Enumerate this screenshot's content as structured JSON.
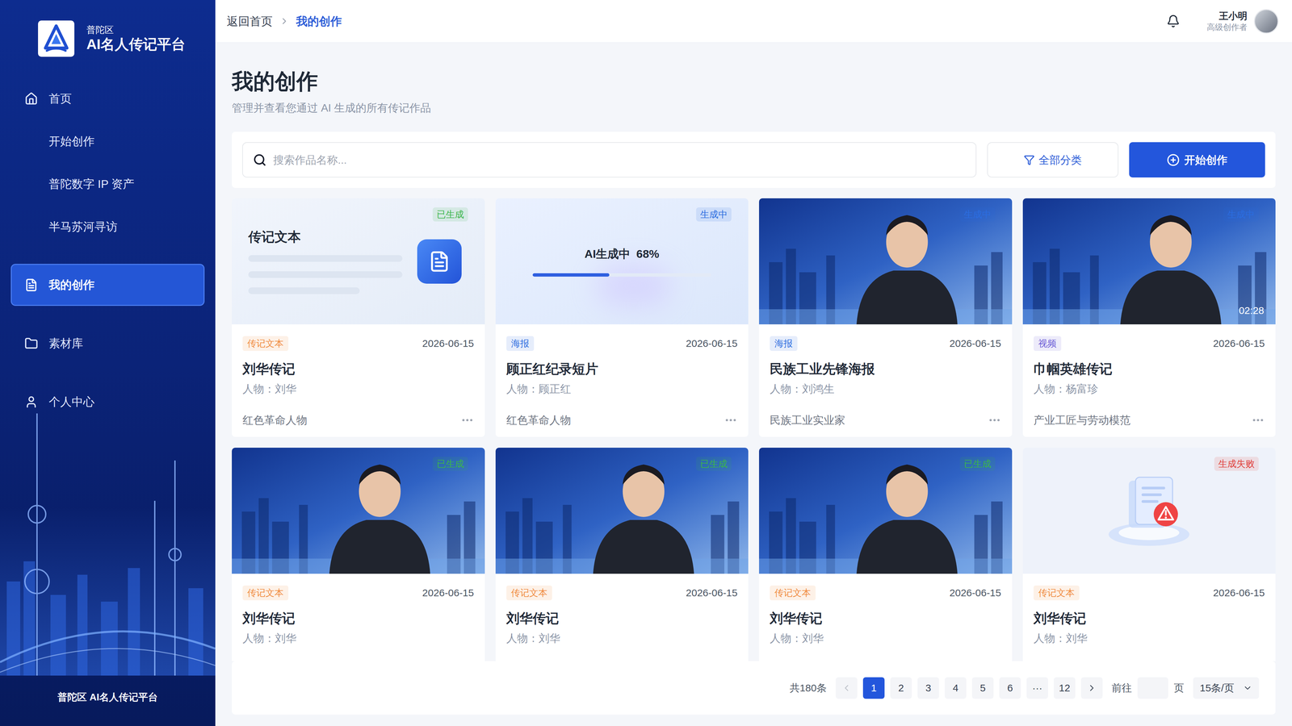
{
  "sidebar": {
    "logo": {
      "subtitle": "普陀区",
      "title": "AI名人传记平台"
    },
    "items": [
      {
        "label": "首页",
        "selected": false
      },
      {
        "label": "开始创作",
        "selected": false
      },
      {
        "label": "普陀数字 IP 资产",
        "selected": false
      },
      {
        "label": "半马苏河寻访",
        "selected": false
      },
      {
        "label": "我的创作",
        "selected": true
      },
      {
        "label": "素材库",
        "selected": false
      },
      {
        "label": "个人中心",
        "selected": false
      }
    ],
    "footer": "普陀区 AI名人传记平台"
  },
  "topbar": {
    "breadcrumb": [
      {
        "label": "返回首页",
        "selected": false
      },
      {
        "label": "我的创作",
        "selected": true
      }
    ],
    "user": {
      "name": "王小明",
      "role": "高级创作者"
    }
  },
  "page": {
    "title": "我的创作",
    "subtitle": "管理并查看您通过 AI 生成的所有传记作品"
  },
  "toolbar": {
    "search_placeholder": "搜索作品名称...",
    "filter_button": "全部分类",
    "create_button": "开始创作"
  },
  "cards": [
    {
      "kind": "text",
      "preview_title": "传记文本",
      "status": {
        "label": "已生成",
        "color": "#3bb54a"
      },
      "tag": {
        "label": "传记文本",
        "color": "#f08a3c"
      },
      "date": "2026-06-15",
      "title": "刘华传记",
      "person": "人物：刘华",
      "category": "红色革命人物"
    },
    {
      "kind": "progress",
      "progress": {
        "label": "AI生成中",
        "reading": "68%",
        "level": 0.43
      },
      "status": {
        "label": "生成中",
        "color": "#2b6de0"
      },
      "tag": {
        "label": "海报",
        "color": "#2f6fe0"
      },
      "date": "2026-06-15",
      "title": "顾正红纪录短片",
      "person": "人物：顾正红",
      "category": "红色革命人物"
    },
    {
      "kind": "photo",
      "status": {
        "label": "生成中",
        "color": "#2b6de0"
      },
      "tag": {
        "label": "海报",
        "color": "#2f6fe0"
      },
      "date": "2026-06-15",
      "title": "民族工业先锋海报",
      "person": "人物：刘鸿生",
      "category": "民族工业实业家"
    },
    {
      "kind": "photo",
      "duration": "02:28",
      "status": {
        "label": "生成中",
        "color": "#2b6de0"
      },
      "tag": {
        "label": "视频",
        "color": "#6b5bd6"
      },
      "date": "2026-06-15",
      "title": "巾帼英雄传记",
      "person": "人物：杨富珍",
      "category": "产业工匠与劳动模范"
    },
    {
      "kind": "photo",
      "status": {
        "label": "已生成",
        "color": "#3bb54a"
      },
      "tag": {
        "label": "传记文本",
        "color": "#f08a3c"
      },
      "date": "2026-06-15",
      "title": "刘华传记",
      "person": "人物：刘华"
    },
    {
      "kind": "photo",
      "status": {
        "label": "已生成",
        "color": "#3bb54a"
      },
      "tag": {
        "label": "传记文本",
        "color": "#f08a3c"
      },
      "date": "2026-06-15",
      "title": "刘华传记",
      "person": "人物：刘华"
    },
    {
      "kind": "photo",
      "status": {
        "label": "已生成",
        "color": "#3bb54a"
      },
      "tag": {
        "label": "传记文本",
        "color": "#f08a3c"
      },
      "date": "2026-06-15",
      "title": "刘华传记",
      "person": "人物：刘华"
    },
    {
      "kind": "failed",
      "status": {
        "label": "生成失败",
        "color": "#e0403a"
      },
      "tag": {
        "label": "传记文本",
        "color": "#f08a3c"
      },
      "date": "2026-06-15",
      "title": "刘华传记",
      "person": "人物：刘华"
    }
  ],
  "pagination": {
    "total": "共180条",
    "prev_disabled": true,
    "pages": [
      {
        "label": "1",
        "selected": true
      },
      {
        "label": "2",
        "selected": false
      },
      {
        "label": "3",
        "selected": false
      },
      {
        "label": "4",
        "selected": false
      },
      {
        "label": "5",
        "selected": false
      },
      {
        "label": "6",
        "selected": false
      },
      {
        "label": "···",
        "selected": false
      },
      {
        "label": "12",
        "selected": false
      }
    ],
    "goto_label": "前往",
    "goto_suffix": "页",
    "page_size": "15条/页"
  }
}
